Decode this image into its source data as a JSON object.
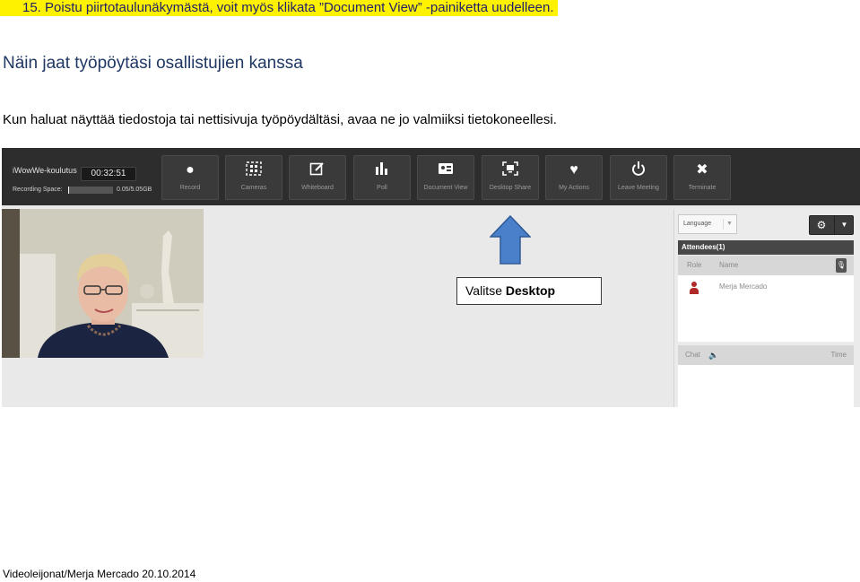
{
  "document": {
    "step_text": "15. Poistu piirtotaulunäkymästä, voit myös klikata ”Document View” -painiketta uudelleen.",
    "heading": "Näin jaat työpöytäsi osallistujien kanssa",
    "paragraph": "Kun haluat näyttää tiedostoja tai nettisivuja työpöydältäsi, avaa ne jo valmiiksi tietokoneellesi.",
    "footer": "Videoleijonat/Merja Mercado 20.10.2014"
  },
  "colors": {
    "highlight": "#fff200",
    "heading": "#1f3864",
    "toolbar_bg": "#2d2d2d",
    "arrow_fill": "#4a7fc9",
    "role_icon": "#b02a2a"
  },
  "app": {
    "room_name": "iWowWe-koulutus",
    "timer": "00:32:51",
    "recording_space_label": "Recording Space:",
    "recording_space_value": "0.05/5.05GB",
    "recording_space_fraction": 0.01,
    "toolbar": [
      {
        "label": "Record",
        "icon": "record-dot-icon"
      },
      {
        "label": "Cameras",
        "icon": "cameras-icon"
      },
      {
        "label": "Whiteboard",
        "icon": "whiteboard-icon"
      },
      {
        "label": "Poll",
        "icon": "poll-bars-icon"
      },
      {
        "label": "Document View",
        "icon": "document-view-icon"
      },
      {
        "label": "Desktop Share",
        "icon": "desktop-share-icon"
      },
      {
        "label": "My Actions",
        "icon": "heart-icon"
      },
      {
        "label": "Leave Meeting",
        "icon": "power-icon"
      },
      {
        "label": "Terminate",
        "icon": "close-x-icon"
      }
    ],
    "callout": {
      "prefix": "Valitse ",
      "bold": "Desktop"
    },
    "right_panel": {
      "language_select": "Language",
      "attendees_header": "Attendees(1)",
      "col_role": "Role",
      "col_name": "Name",
      "attendee_name": "Merja Mercado",
      "chat_label": "Chat",
      "chat_time": "Time"
    }
  }
}
